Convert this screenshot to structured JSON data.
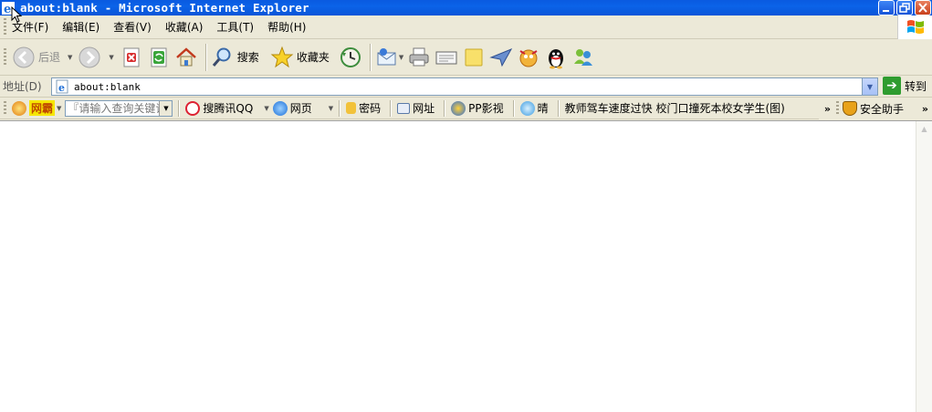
{
  "window": {
    "title": "about:blank - Microsoft Internet Explorer"
  },
  "menu": {
    "items": [
      "文件(F)",
      "编辑(E)",
      "查看(V)",
      "收藏(A)",
      "工具(T)",
      "帮助(H)"
    ]
  },
  "toolbar": {
    "back_label": "后退",
    "search_label": "搜索",
    "favorites_label": "收藏夹"
  },
  "address": {
    "label": "地址(D)",
    "url": "about:blank",
    "go_label": "转到"
  },
  "linkbar": {
    "wangba_label": "网霸",
    "search_placeholder": "『请输入查询关键词』",
    "items": {
      "sogou_qq": "搜腾讯QQ",
      "web": "网页",
      "password": "密码",
      "url": "网址",
      "pp_video": "PP影视",
      "weather": "晴",
      "news": "教师驾车速度过快 校门口撞死本校女学生(图)",
      "safety": "安全助手"
    }
  },
  "colors": {
    "titlebar": "#0b63e8",
    "toolbar_bg": "#ece9d8",
    "content_bg": "#ffffff"
  }
}
